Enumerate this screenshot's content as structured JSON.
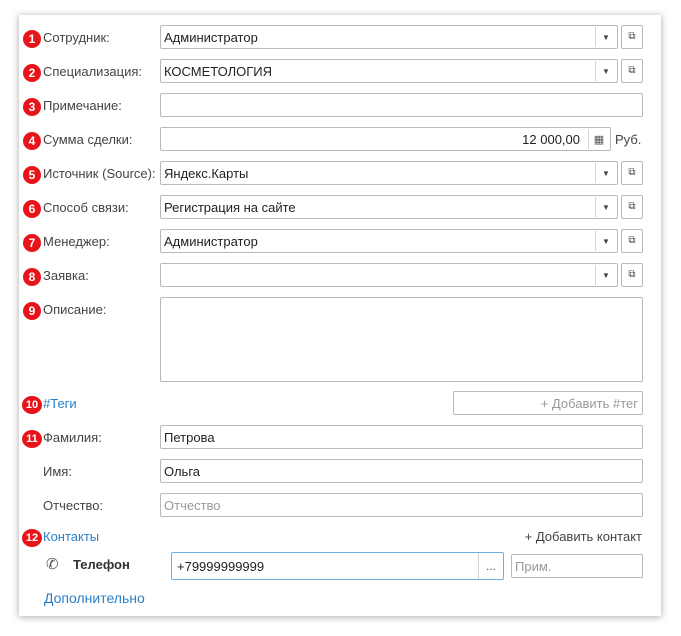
{
  "colors": {
    "badge": "#e8141b",
    "link": "#2b7fc8",
    "focus_border": "#6eaee3"
  },
  "fields": [
    {
      "num": "1",
      "label": "Сотрудник:",
      "value": "Администратор"
    },
    {
      "num": "2",
      "label": "Специализация:",
      "value": "КОСМЕТОЛОГИЯ"
    },
    {
      "num": "3",
      "label": "Примечание:",
      "value": ""
    },
    {
      "num": "4",
      "label": "Сумма сделки:",
      "value": "12 000,00",
      "unit": "Руб."
    },
    {
      "num": "5",
      "label": "Источник (Source):",
      "value": "Яндекс.Карты"
    },
    {
      "num": "6",
      "label": "Способ связи:",
      "value": "Регистрация на сайте"
    },
    {
      "num": "7",
      "label": "Менеджер:",
      "value": "Администратор"
    },
    {
      "num": "8",
      "label": "Заявка:",
      "value": ""
    },
    {
      "num": "9",
      "label": "Описание:",
      "value": ""
    }
  ],
  "tags": {
    "num": "10",
    "label": "#Теги",
    "placeholder": "+ Добавить #тег"
  },
  "person": {
    "num": "11",
    "last_name_label": "Фамилия:",
    "last_name": "Петрова",
    "first_name_label": "Имя:",
    "first_name": "Ольга",
    "middle_name_label": "Отчество:",
    "middle_name_placeholder": "Отчество"
  },
  "contacts": {
    "num": "12",
    "label": "Контакты",
    "add_label": "+ Добавить контакт",
    "phone_label": "Телефон",
    "phone_value": "+79999999999",
    "note_placeholder": "Прим.",
    "dots": "..."
  },
  "more_label": "Дополнительно",
  "icons": {
    "dropdown": "▼",
    "open": "⧉",
    "calculator": "▦",
    "phone": "✆"
  }
}
